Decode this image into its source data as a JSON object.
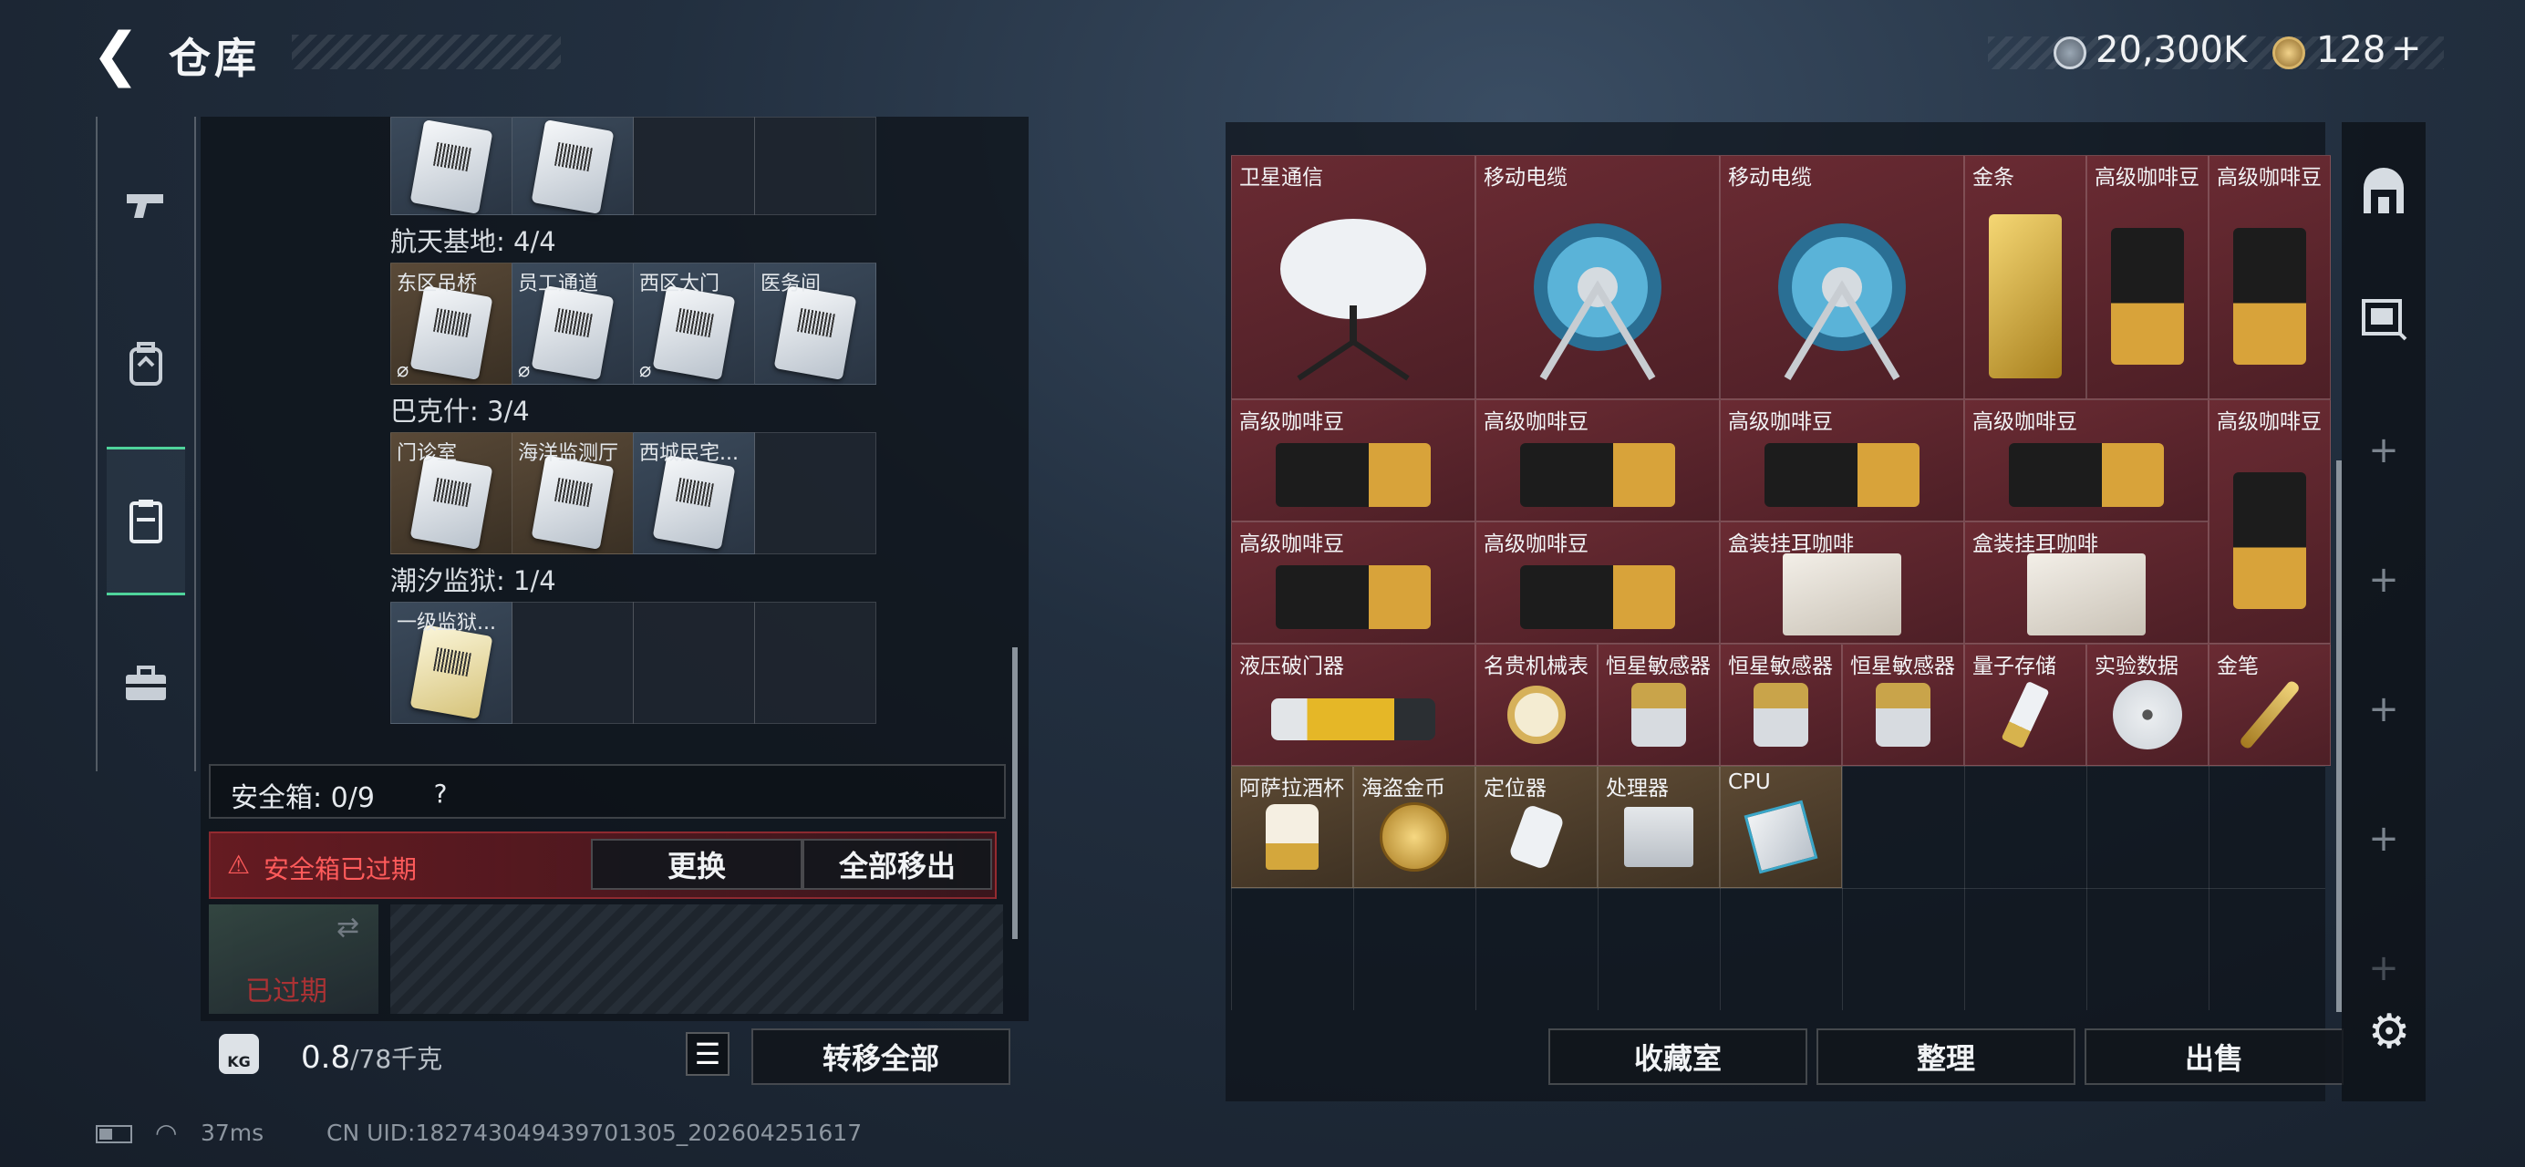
{
  "header": {
    "back_icon": "chevron-left-icon",
    "title": "仓库",
    "currency_silver": "20,300K",
    "currency_gold": "128",
    "currency_gold_plus": "+"
  },
  "left_rail": {
    "items": [
      {
        "icon": "pistol-icon"
      },
      {
        "icon": "backpack-icon"
      },
      {
        "icon": "locker-icon",
        "selected": true
      },
      {
        "icon": "briefcase-icon"
      }
    ]
  },
  "keycard_groups": [
    {
      "label": "航天基地: 4/4",
      "slots": [
        "东区吊桥",
        "员工通道",
        "西区大门",
        "医务间"
      ]
    },
    {
      "label": "巴克什: 3/4",
      "slots": [
        "门诊室",
        "海洋监测厅",
        "西城民宅...",
        ""
      ]
    },
    {
      "label": "潮汐监狱: 1/4",
      "slots": [
        "一级监狱...",
        "",
        "",
        ""
      ]
    }
  ],
  "safe_box": {
    "label": "安全箱: 0/9",
    "help": "?",
    "expired_msg": "安全箱已过期",
    "replace_label": "更换",
    "remove_all_label": "全部移出",
    "case_status": "已过期"
  },
  "weight": {
    "current": "0.8",
    "capacity": "/78千克",
    "icon_label": "KG"
  },
  "transfer_all_label": "转移全部",
  "status_bar": {
    "ping": "37ms",
    "uid": "CN UID:182743049439701305_202604251617"
  },
  "storage_items": [
    {
      "name": "卫星通信",
      "color": "red"
    },
    {
      "name": "移动电缆",
      "color": "red"
    },
    {
      "name": "移动电缆",
      "color": "red"
    },
    {
      "name": "金条",
      "color": "red"
    },
    {
      "name": "高级咖啡豆",
      "color": "red"
    },
    {
      "name": "高级咖啡豆",
      "color": "red"
    },
    {
      "name": "高级咖啡豆",
      "color": "red"
    },
    {
      "name": "高级咖啡豆",
      "color": "red"
    },
    {
      "name": "高级咖啡豆",
      "color": "red"
    },
    {
      "name": "高级咖啡豆",
      "color": "red"
    },
    {
      "name": "高级咖啡豆",
      "color": "red"
    },
    {
      "name": "高级咖啡豆",
      "color": "red"
    },
    {
      "name": "高级咖啡豆",
      "color": "red"
    },
    {
      "name": "盒装挂耳咖啡",
      "color": "red"
    },
    {
      "name": "盒装挂耳咖啡",
      "color": "red"
    },
    {
      "name": "液压破门器",
      "color": "red"
    },
    {
      "name": "名贵机械表",
      "color": "red"
    },
    {
      "name": "恒星敏感器",
      "color": "red"
    },
    {
      "name": "恒星敏感器",
      "color": "red"
    },
    {
      "name": "恒星敏感器",
      "color": "red"
    },
    {
      "name": "量子存储",
      "color": "red"
    },
    {
      "name": "实验数据",
      "color": "red"
    },
    {
      "name": "金笔",
      "color": "red"
    },
    {
      "name": "阿萨拉酒杯",
      "color": "gold"
    },
    {
      "name": "海盗金币",
      "color": "gold"
    },
    {
      "name": "定位器",
      "color": "gold"
    },
    {
      "name": "处理器",
      "color": "gold"
    },
    {
      "name": "CPU",
      "color": "gold"
    }
  ],
  "bottom_buttons": {
    "collection": "收藏室",
    "organize": "整理",
    "sell": "出售"
  },
  "right_rail": {
    "items": [
      "storage-icon",
      "keycard-rack-icon"
    ],
    "add_slots": [
      "+",
      "+",
      "+",
      "+",
      "+",
      "+"
    ],
    "settings_icon": "gear-icon"
  },
  "colors": {
    "accent_green": "#4fd39b",
    "rarity_red": "#6a2b33",
    "rarity_gold": "#5d4a34",
    "warning_red": "#ff5b5b"
  }
}
